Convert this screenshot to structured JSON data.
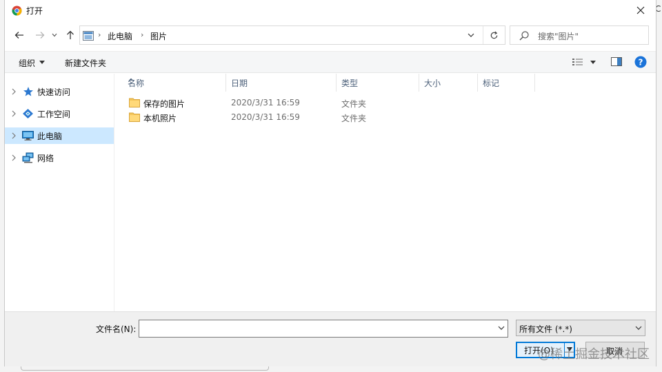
{
  "window": {
    "title": "打开",
    "app_icon": "chrome-icon",
    "background_fragment": "C"
  },
  "address_bar": {
    "root_icon": "this-pc-icon",
    "breadcrumb": [
      "此电脑",
      "图片"
    ]
  },
  "search": {
    "placeholder": "搜索\"图片\""
  },
  "toolbar": {
    "organize_label": "组织",
    "new_folder_label": "新建文件夹"
  },
  "nav_pane": {
    "items": [
      {
        "label": "快速访问",
        "icon": "star-icon",
        "selected": false
      },
      {
        "label": "工作空间",
        "icon": "workspace-icon",
        "selected": false
      },
      {
        "label": "此电脑",
        "icon": "computer-icon",
        "selected": true
      },
      {
        "label": "网络",
        "icon": "network-icon",
        "selected": false
      }
    ]
  },
  "file_list": {
    "columns": [
      "名称",
      "日期",
      "类型",
      "大小",
      "标记"
    ],
    "sorted_column": "名称",
    "rows": [
      {
        "name": "保存的图片",
        "date": "2020/3/31 16:59",
        "type": "文件夹",
        "icon": "folder-icon"
      },
      {
        "name": "本机照片",
        "date": "2020/3/31 16:59",
        "type": "文件夹",
        "icon": "folder-icon"
      }
    ]
  },
  "bottom": {
    "filename_label": "文件名(N):",
    "filename_value": "",
    "filetype_selected": "所有文件 (*.*)",
    "open_label": "打开(O)",
    "cancel_label": "取消"
  },
  "watermark": "@稀土掘金技术社区",
  "colors": {
    "selection": "#cce8ff",
    "accent": "#0078d7",
    "header_text": "#4c607a",
    "help": "#1a73d9"
  }
}
